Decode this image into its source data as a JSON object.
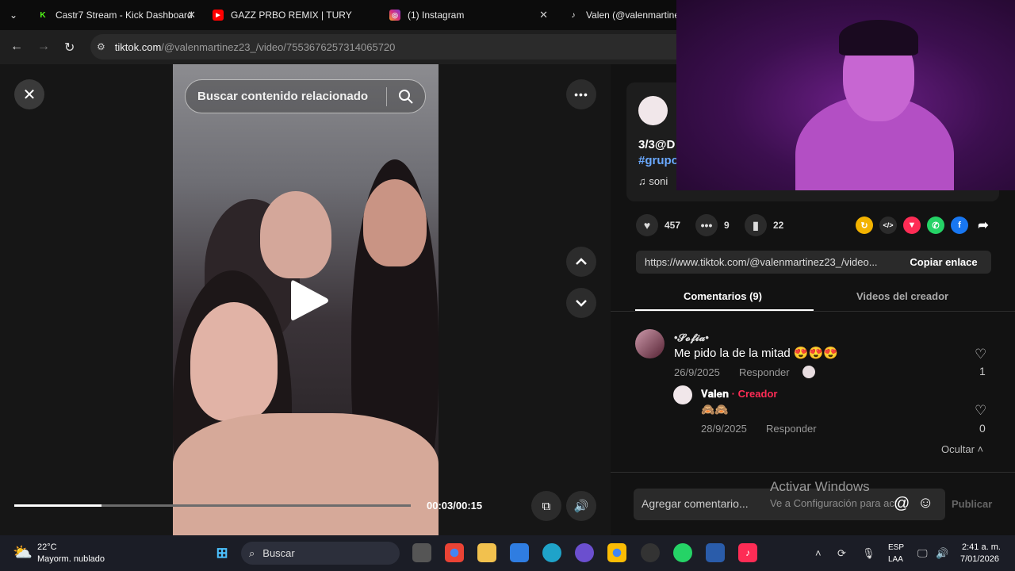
{
  "browser": {
    "tabs": [
      {
        "title": "Castr7 Stream - Kick Dashboard",
        "fav": "K"
      },
      {
        "title": "GAZZ PRBO REMIX | TURY",
        "fav": "▶"
      },
      {
        "title": "(1) Instagram",
        "fav": "◎"
      },
      {
        "title": "Valen (@valenmartinez",
        "fav": "♪"
      }
    ],
    "url_host": "tiktok.com",
    "url_path": "/@valenmartinez23_/video/7553676257314065720"
  },
  "player": {
    "search_placeholder": "Buscar contenido relacionado",
    "time": "00:03/00:15",
    "progress": 0.22
  },
  "post": {
    "caption_1": "3/3@D",
    "caption_2": "#grupo",
    "sound": "soni",
    "likes": "457",
    "comments": "9",
    "saves": "22",
    "link": "https://www.tiktok.com/@valenmartinez23_/video...",
    "copy_label": "Copiar enlace",
    "tab_comments": "Comentarios (9)",
    "tab_videos": "Videos del creador"
  },
  "comments": [
    {
      "user": "•𝓢𝓸𝓯𝓲𝓪•",
      "text": "Me pido la de la mitad 😍😍😍",
      "date": "26/9/2025",
      "reply": "Responder",
      "likes": "1"
    },
    {
      "user": "𝐕𝐚𝐥𝐞𝐧",
      "badge": "· Creador",
      "text": "🙈🙈",
      "date": "28/9/2025",
      "reply": "Responder",
      "likes": "0"
    }
  ],
  "hide_label": "Ocultar",
  "comment_input_placeholder": "Agregar comentario...",
  "publish_label": "Publicar",
  "activate": {
    "title": "Activar Windows",
    "sub": "Ve a Configuración para activar Windows."
  },
  "taskbar": {
    "temp": "22°C",
    "weather": "Mayorm. nublado",
    "search": "Buscar",
    "lang1": "ESP",
    "lang2": "LAA",
    "clock": "2:41 a. m.",
    "date": "7/01/2026"
  },
  "colors": {
    "accent": "#fe2c55",
    "tiktok_pink": "#ff3b5c"
  }
}
